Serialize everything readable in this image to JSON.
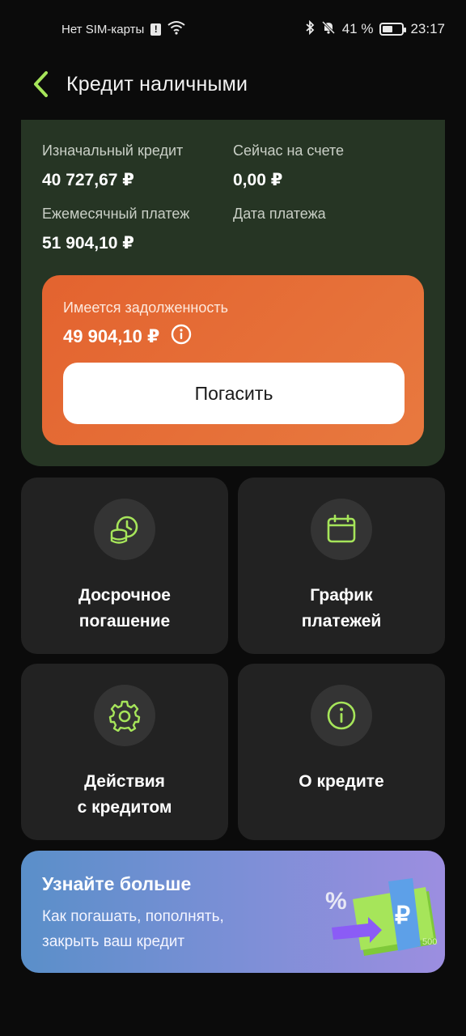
{
  "status_bar": {
    "sim_text": "Нет SIM-карты",
    "sim_alert": "!",
    "battery_percent": "41 %",
    "time": "23:17"
  },
  "header": {
    "title": "Кредит наличными",
    "back_icon": "chevron-left-icon"
  },
  "credit": {
    "initial_label": "Изначальный кредит",
    "initial_value": "40 727,67 ₽",
    "balance_label": "Сейчас на счете",
    "balance_value": "0,00 ₽",
    "monthly_label": "Ежемесячный платеж",
    "monthly_value": "51 904,10 ₽",
    "date_label": "Дата платежа"
  },
  "debt": {
    "label": "Имеется задолженность",
    "amount": "49 904,10 ₽",
    "info_icon": "info-circle-icon",
    "pay_button": "Погасить"
  },
  "tiles": [
    {
      "icon": "coins-clock-icon",
      "line1": "Досрочное",
      "line2": "погашение"
    },
    {
      "icon": "calendar-icon",
      "line1": "График",
      "line2": "платежей"
    },
    {
      "icon": "gear-icon",
      "line1": "Действия",
      "line2": "с кредитом"
    },
    {
      "icon": "info-icon",
      "line1": "О кредите",
      "line2": ""
    }
  ],
  "promo": {
    "title": "Узнайте больше",
    "line1": "Как погашать, пополнять,",
    "line2": "закрыть ваш кредит",
    "art": "money-stack-illustration"
  },
  "colors": {
    "accent": "#a6e55a",
    "card_bg": "#263524",
    "debt_bg": "#e3632f",
    "tile_bg": "#222222"
  }
}
